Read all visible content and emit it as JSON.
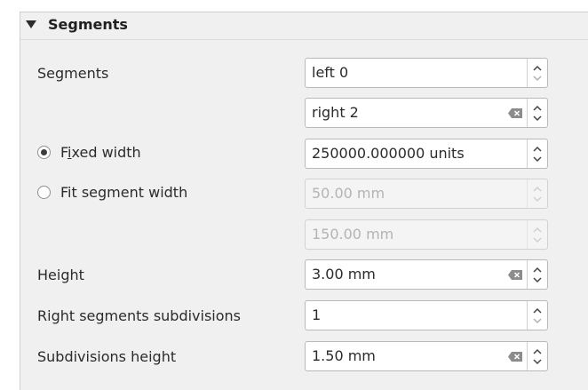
{
  "section": {
    "title": "Segments"
  },
  "rows": {
    "segments_label": "Segments",
    "left_value": "left 0",
    "right_value": "right 2",
    "fixed_width_label_pre": "F",
    "fixed_width_label_u": "i",
    "fixed_width_label_post": "xed width",
    "fixed_width_value": "250000.000000 units",
    "fit_segment_label": "Fit segment width",
    "fit_min_value": "50.00 mm",
    "fit_max_value": "150.00 mm",
    "height_label": "Height",
    "height_value": "3.00 mm",
    "right_subdivisions_label": "Right segments subdivisions",
    "right_subdivisions_value": "1",
    "subdivisions_height_label": "Subdivisions height",
    "subdivisions_height_value": "1.50 mm"
  },
  "state": {
    "fixed_width_checked": true,
    "fit_segment_checked": false
  },
  "colors": {
    "panel_bg": "#f0f0f0",
    "field_bg": "#ffffff",
    "disabled_text": "#b4b4b4"
  },
  "icons": [
    "collapse-triangle-icon",
    "clear-text-icon",
    "spin-up-icon",
    "spin-down-icon"
  ]
}
